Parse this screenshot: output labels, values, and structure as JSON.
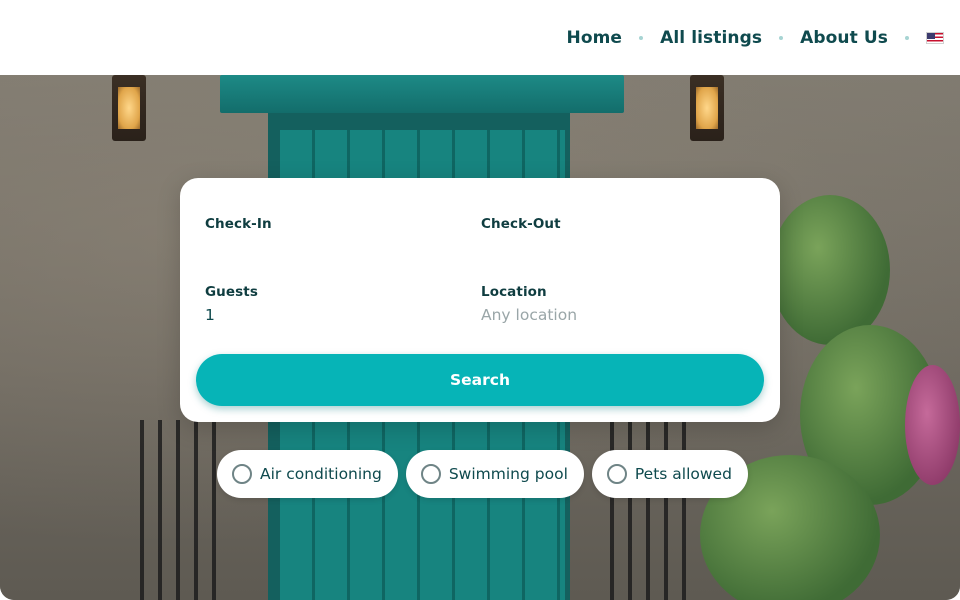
{
  "nav": {
    "items": [
      {
        "label": "Home"
      },
      {
        "label": "All listings"
      },
      {
        "label": "About Us"
      }
    ],
    "language_icon": "us-flag-icon"
  },
  "search": {
    "checkin_label": "Check-In",
    "checkin_value": "",
    "checkout_label": "Check-Out",
    "checkout_value": "",
    "guests_label": "Guests",
    "guests_value": "1",
    "location_label": "Location",
    "location_placeholder": "Any location",
    "search_button_label": "Search"
  },
  "amenities": [
    {
      "label": "Air conditioning",
      "checked": false
    },
    {
      "label": "Swimming pool",
      "checked": false
    },
    {
      "label": "Pets allowed",
      "checked": false
    }
  ],
  "colors": {
    "accent": "#06b4b7",
    "text_primary": "#0f4a4e"
  }
}
